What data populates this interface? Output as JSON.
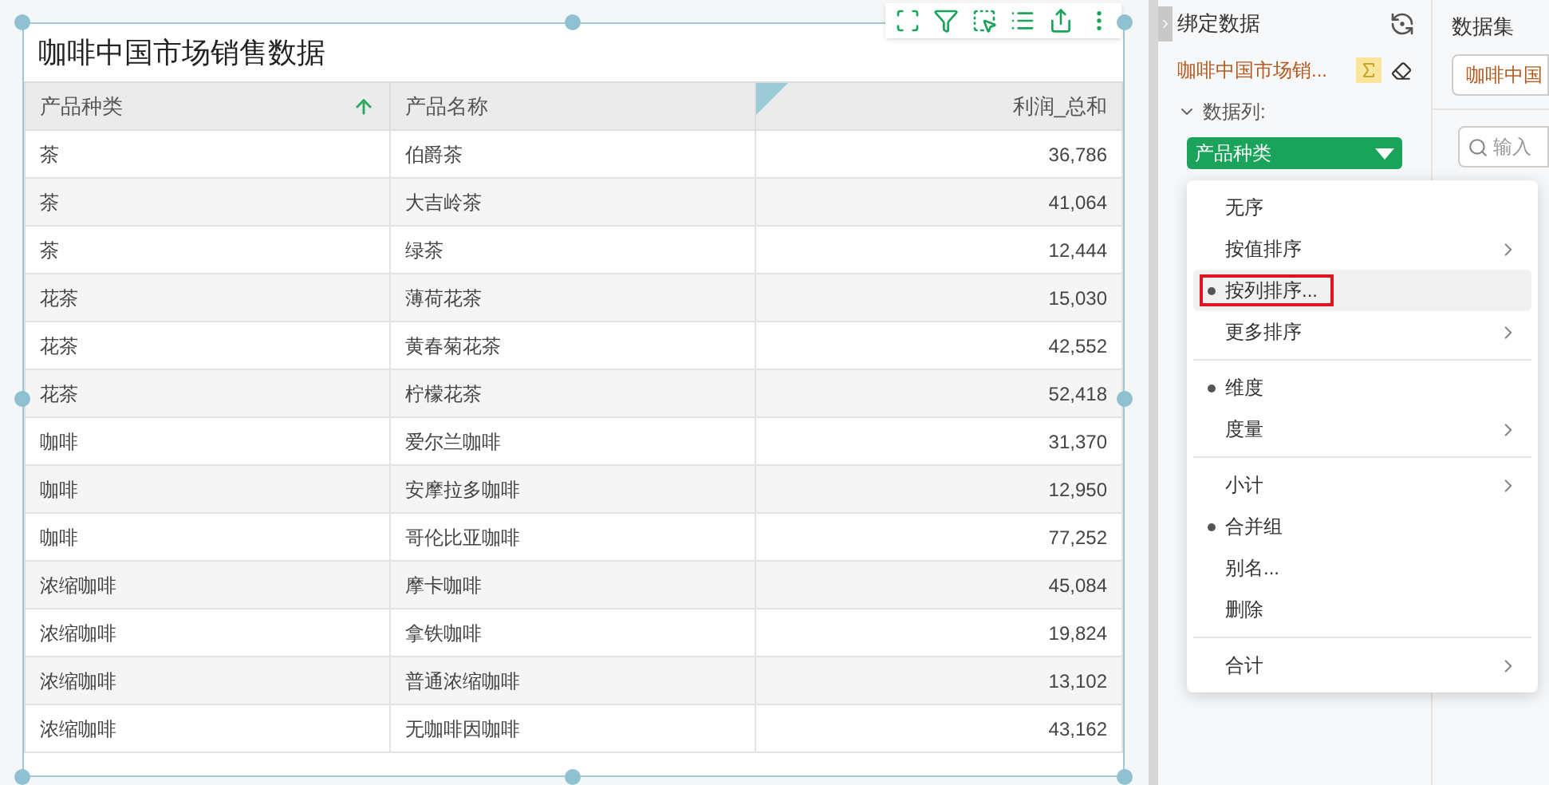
{
  "widget": {
    "title": "咖啡中国市场销售数据"
  },
  "table": {
    "columns": [
      {
        "label": "产品种类",
        "sorted_ascending": true,
        "selected": false
      },
      {
        "label": "产品名称",
        "sorted_ascending": false,
        "selected": false
      },
      {
        "label": "利润_总和",
        "sorted_ascending": false,
        "selected": true
      }
    ],
    "rows": [
      [
        "茶",
        "伯爵茶",
        "36,786"
      ],
      [
        "茶",
        "大吉岭茶",
        "41,064"
      ],
      [
        "茶",
        "绿茶",
        "12,444"
      ],
      [
        "花茶",
        "薄荷花茶",
        "15,030"
      ],
      [
        "花茶",
        "黄春菊花茶",
        "42,552"
      ],
      [
        "花茶",
        "柠檬花茶",
        "52,418"
      ],
      [
        "咖啡",
        "爱尔兰咖啡",
        "31,370"
      ],
      [
        "咖啡",
        "安摩拉多咖啡",
        "12,950"
      ],
      [
        "咖啡",
        "哥伦比亚咖啡",
        "77,252"
      ],
      [
        "浓缩咖啡",
        "摩卡咖啡",
        "45,084"
      ],
      [
        "浓缩咖啡",
        "拿铁咖啡",
        "19,824"
      ],
      [
        "浓缩咖啡",
        "普通浓缩咖啡",
        "13,102"
      ],
      [
        "浓缩咖啡",
        "无咖啡因咖啡",
        "43,162"
      ]
    ]
  },
  "bind_panel": {
    "title": "绑定数据",
    "dataset": "咖啡中国市场销...",
    "section": "数据列:",
    "section_expanded": true,
    "field": "产品种类"
  },
  "dataset_panel": {
    "title": "数据集",
    "dataset": "咖啡中国",
    "search_placeholder": "输入"
  },
  "menu": [
    {
      "kind": "item",
      "label": "无序",
      "bullet": false,
      "submenu": false,
      "selected": false,
      "annotated": false
    },
    {
      "kind": "item",
      "label": "按值排序",
      "bullet": false,
      "submenu": true,
      "selected": false,
      "annotated": false
    },
    {
      "kind": "item",
      "label": "按列排序...",
      "bullet": true,
      "submenu": false,
      "selected": true,
      "annotated": true
    },
    {
      "kind": "item",
      "label": "更多排序",
      "bullet": false,
      "submenu": true,
      "selected": false,
      "annotated": false
    },
    {
      "kind": "separator"
    },
    {
      "kind": "item",
      "label": "维度",
      "bullet": true,
      "submenu": false,
      "selected": false,
      "annotated": false
    },
    {
      "kind": "item",
      "label": "度量",
      "bullet": false,
      "submenu": true,
      "selected": false,
      "annotated": false
    },
    {
      "kind": "separator"
    },
    {
      "kind": "item",
      "label": "小计",
      "bullet": false,
      "submenu": true,
      "selected": false,
      "annotated": false
    },
    {
      "kind": "item",
      "label": "合并组",
      "bullet": true,
      "submenu": false,
      "selected": false,
      "annotated": false
    },
    {
      "kind": "item",
      "label": "别名...",
      "bullet": false,
      "submenu": false,
      "selected": false,
      "annotated": false
    },
    {
      "kind": "item",
      "label": "删除",
      "bullet": false,
      "submenu": false,
      "selected": false,
      "annotated": false
    },
    {
      "kind": "separator"
    },
    {
      "kind": "item",
      "label": "合计",
      "bullet": false,
      "submenu": true,
      "selected": false,
      "annotated": false
    }
  ]
}
